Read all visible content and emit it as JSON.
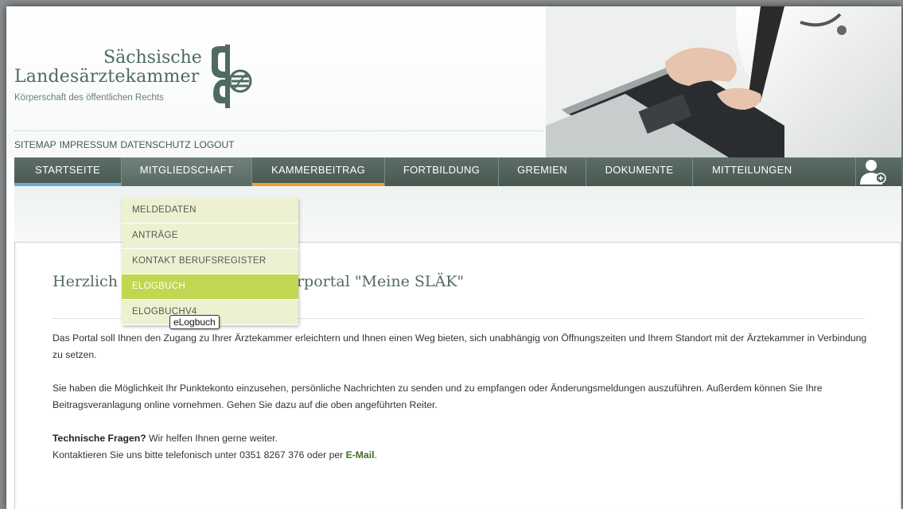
{
  "header": {
    "logo_line1": "Sächsische",
    "logo_line2": "Landesärztekammer",
    "logo_line3": "Körperschaft des öffentlichen Rechts"
  },
  "toplinks": [
    "SITEMAP",
    "IMPRESSUM",
    "DATENSCHUTZ",
    "LOGOUT"
  ],
  "nav": [
    {
      "label": "STARTSEITE",
      "underline": "#6aaad3"
    },
    {
      "label": "MITGLIEDSCHAFT",
      "underline": ""
    },
    {
      "label": "KAMMERBEITRAG",
      "underline": "#e3a62a"
    },
    {
      "label": "FORTBILDUNG",
      "underline": ""
    },
    {
      "label": "GREMIEN",
      "underline": ""
    },
    {
      "label": "DOKUMENTE",
      "underline": ""
    },
    {
      "label": "MITTEILUNGEN",
      "underline": ""
    }
  ],
  "dropdown": [
    {
      "label": "MELDEDATEN"
    },
    {
      "label": "ANTRÄGE"
    },
    {
      "label": "KONTAKT BERUFSREGISTER"
    },
    {
      "label": "ELOGBUCH"
    },
    {
      "label": "ELOGBUCHV4"
    }
  ],
  "tooltip": "eLogbuch",
  "content": {
    "heading_start": "Herzlich",
    "heading_end": "gliederportal \"Meine SLÄK\"",
    "p1": "Das Portal soll Ihnen den Zugang zu Ihrer Ärztekammer erleichtern und Ihnen einen Weg bieten, sich unabhängig von Öffnungszeiten und Ihrem Standort mit der Ärztekammer in Verbindung zu setzen.",
    "p2": "Sie haben die Möglichkeit Ihr Punktekonto einzusehen, persönliche Nachrichten zu senden und zu empfangen oder Änderungsmeldungen auszuführen. Außerdem können Sie Ihre Beitragsveranlagung online vornehmen. Gehen Sie dazu auf die oben angeführten Reiter.",
    "p3_bold": "Technische Fragen?",
    "p3_rest": " Wir helfen Ihnen gerne weiter.",
    "p4_text": "Kontaktieren Sie uns bitte telefonisch unter 0351 8267 376 oder per ",
    "p4_link": "E-Mail",
    "p4_end": "."
  },
  "colors": {
    "nav_bg": "#52625b",
    "dropdown_bg": "#eef1d1",
    "dropdown_highlight": "#c3d651",
    "brand": "#4f6a5f"
  }
}
